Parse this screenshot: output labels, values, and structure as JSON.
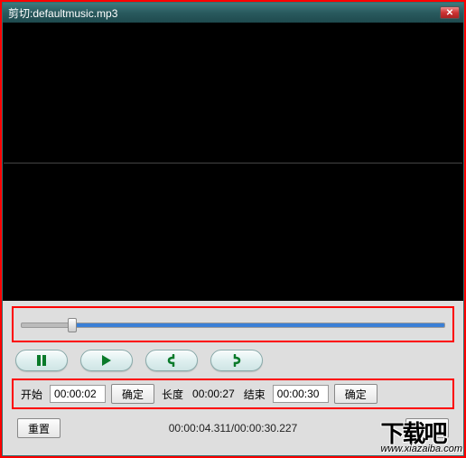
{
  "titlebar": {
    "title": "剪切:defaultmusic.mp3"
  },
  "trim": {
    "start_label": "开始",
    "start_value": "00:00:02",
    "start_confirm": "确定",
    "length_label": "长度",
    "length_value": "00:00:27",
    "end_label": "结束",
    "end_value": "00:00:30",
    "end_confirm": "确定"
  },
  "bottom": {
    "reset_label": "重置",
    "time_counter": "00:00:04.311/00:00:30.227",
    "confirm_label": "确定"
  },
  "icons": {
    "pause": "pause-icon",
    "play": "play-icon",
    "mark_in": "mark-in-icon",
    "mark_out": "mark-out-icon",
    "close": "close-icon"
  },
  "watermark": {
    "text": "下载吧",
    "url": "www.xiazaiba.com"
  }
}
